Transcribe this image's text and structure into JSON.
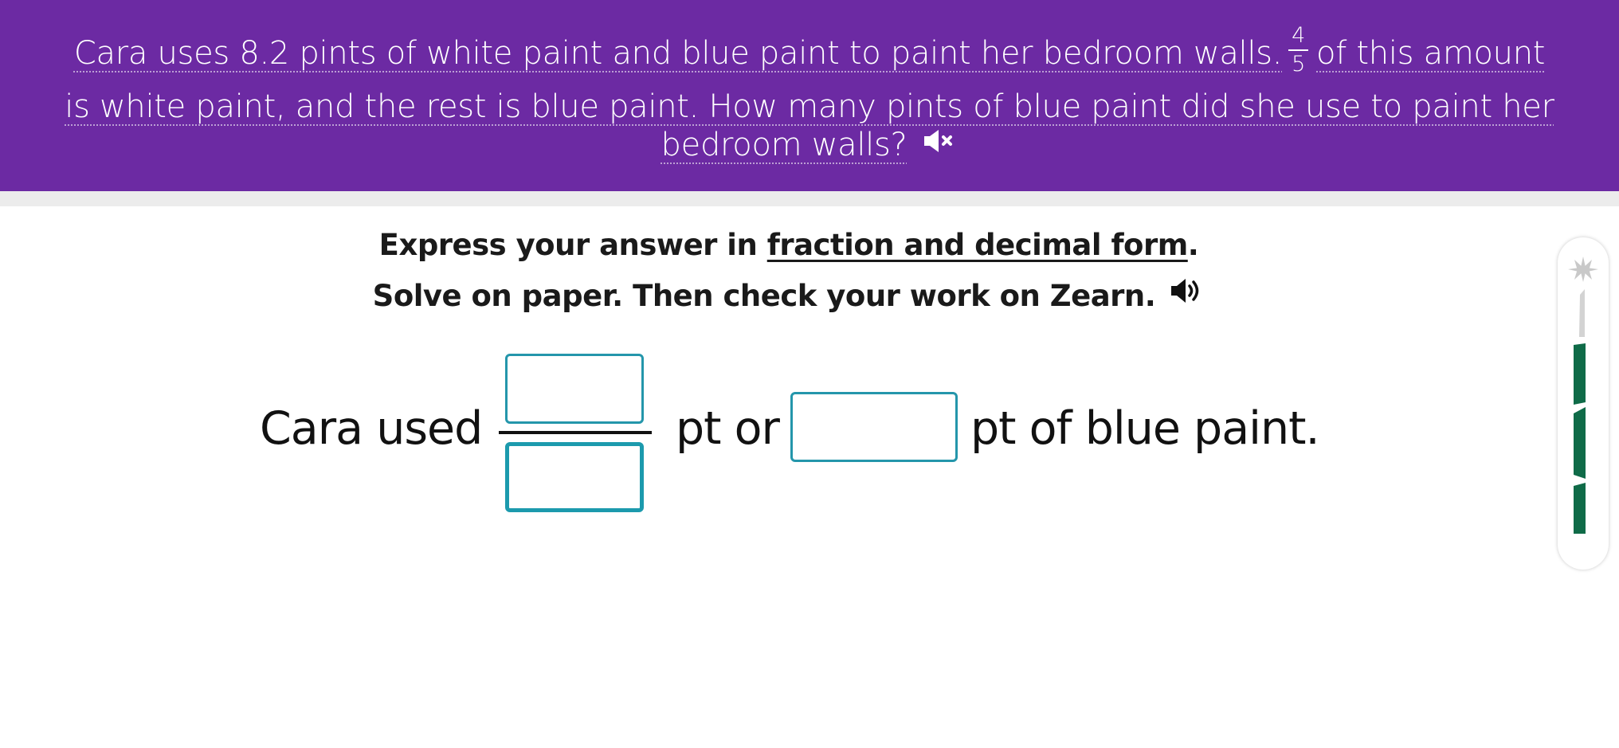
{
  "question": {
    "line1_before": "Cara uses 8.2 pints of white paint and blue paint to paint her bedroom walls.",
    "fraction": {
      "numerator": "4",
      "denominator": "5"
    },
    "line1_after": "of this amount",
    "line2": "is white paint, and the rest is blue paint. How many pints of blue paint did she use to paint her",
    "line3": "bedroom walls?",
    "audio_icon": "speaker-muted-icon"
  },
  "instructions": {
    "line1_prefix": "Express your answer in",
    "line1_emphasis": "fraction and decimal form",
    "line1_suffix": ".",
    "line2": "Solve on paper. Then check your work on Zearn.",
    "audio_icon": "speaker-icon"
  },
  "answer": {
    "lead_text": "Cara used",
    "middle_text": "pt or",
    "end_text": "pt of blue paint.",
    "numerator_value": "",
    "denominator_value": "",
    "decimal_value": ""
  },
  "progress": {
    "icon": "star-burst-icon",
    "segments_total": 4,
    "segments_completed": 3
  },
  "colors": {
    "banner": "#6c2aa3",
    "input_border": "#2496ab",
    "progress_complete": "#0f6b48",
    "progress_pending": "#d3d3d3"
  }
}
